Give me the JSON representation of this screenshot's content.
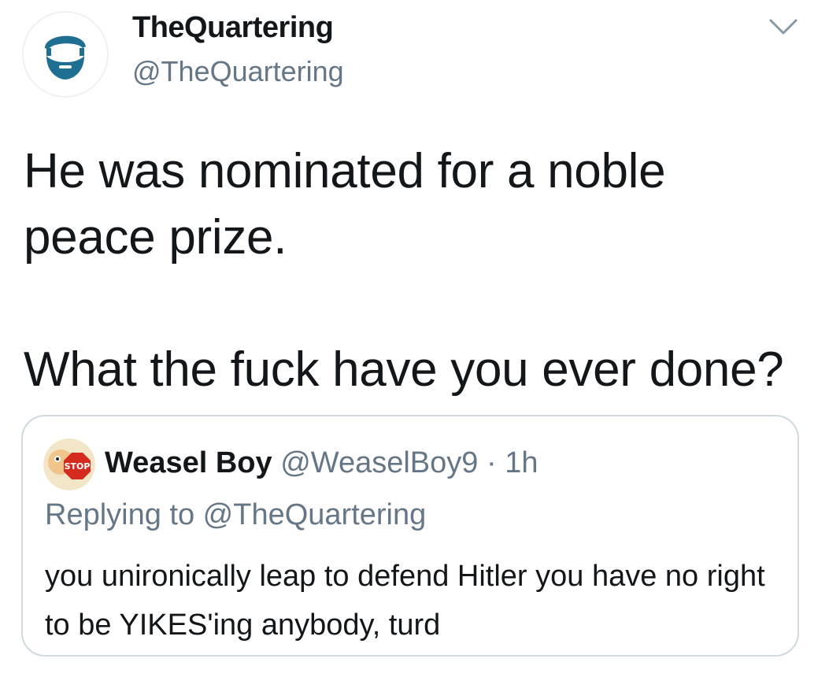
{
  "tweet": {
    "author": {
      "display_name": "TheQuartering",
      "handle": "@TheQuartering",
      "avatar_icon": "bearded-man-logo-icon",
      "avatar_color": "#1f6f92"
    },
    "menu_icon": "chevron-down-icon",
    "text_lines": [
      "He was nominated for a noble peace prize.",
      "What the fuck have you ever done?"
    ]
  },
  "quoted_tweet": {
    "author": {
      "display_name": "Weasel Boy",
      "handle": "@WeaselBoy9",
      "avatar_icon": "stop-sign-avatar-icon"
    },
    "separator": "·",
    "time": "1h",
    "replying_to": "Replying to @TheQuartering",
    "text": "you unironically leap to defend Hitler you have no right to be YIKES'ing anybody, turd"
  },
  "colors": {
    "primary_text": "#14171a",
    "secondary_text": "#657786",
    "border": "#cfd9de",
    "background": "#ffffff"
  }
}
